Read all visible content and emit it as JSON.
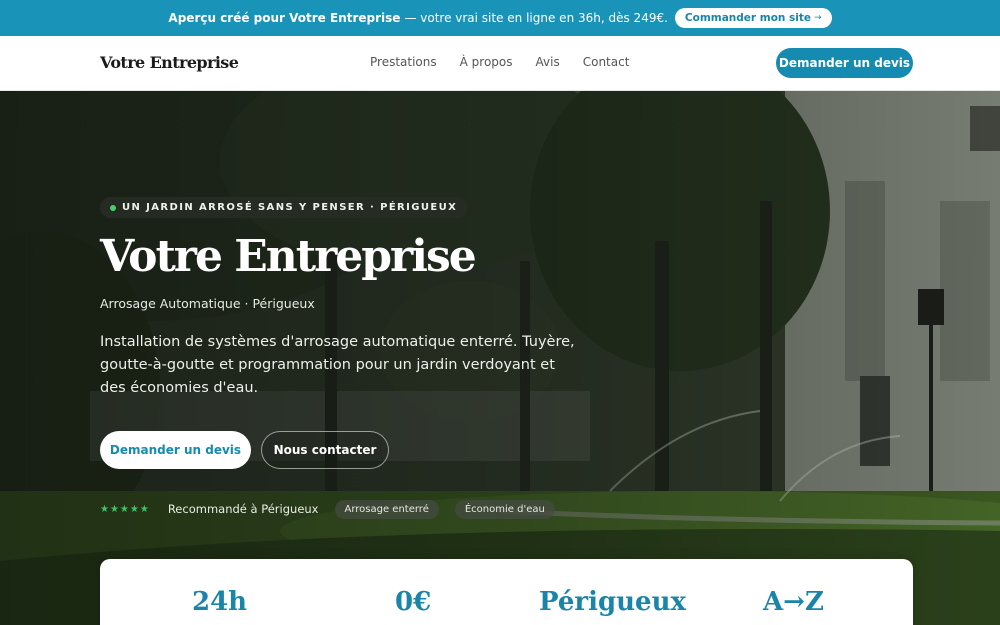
{
  "promo": {
    "bold_text": "Aperçu créé pour Votre Entreprise",
    "rest_text": "— votre vrai site en ligne en 36h, dès 249€.",
    "button_label": "Commander mon site",
    "button_arrow": "→"
  },
  "header": {
    "logo": "Votre Entreprise",
    "nav": [
      "Prestations",
      "À propos",
      "Avis",
      "Contact"
    ],
    "cta_label": "Demander un devis"
  },
  "hero": {
    "badge": "UN JARDIN ARROSÉ SANS Y PENSER · PÉRIGUEUX",
    "title": "Votre Entreprise",
    "subtitle": "Arrosage Automatique · Périgueux",
    "description": "Installation de systèmes d'arrosage automatique enterré. Tuyère, goutte-à-goutte et programmation pour un jardin verdoyant et des économies d'eau.",
    "primary_button": "Demander un devis",
    "secondary_button": "Nous contacter",
    "stars": "★★★★★",
    "recommendation": "Recommandé à Périgueux",
    "tags": [
      "Arrosage enterré",
      "Économie d'eau"
    ]
  },
  "stats": [
    "24h",
    "0€",
    "Périgueux",
    "A→Z"
  ],
  "colors": {
    "accent": "#168bb1",
    "promo_bg": "#1a93b8",
    "star_green": "#3fc167"
  }
}
